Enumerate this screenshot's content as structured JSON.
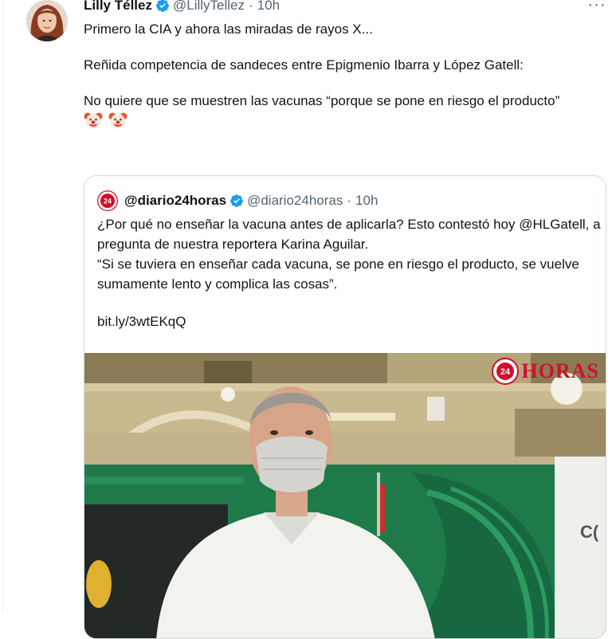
{
  "tweet": {
    "author_name": "Lilly Téllez",
    "handle": "@LillyTellez",
    "separator": "·",
    "time": "10h",
    "more": "···",
    "avatar_icon": "profile-photo-woman",
    "text": {
      "line1": "Primero la CIA y ahora las miradas de rayos X...",
      "line2": "Reñida competencia de sandeces entre Epigmenio Ibarra y López Gatell:",
      "line3": "No quiere que se muestren las vacunas “porque se pone en riesgo el producto”"
    },
    "emojis": [
      "clown-face-emoji",
      "clown-face-emoji"
    ]
  },
  "quoted": {
    "author_name": "@diario24horas",
    "handle": "@diario24horas",
    "separator": "·",
    "time": "10h",
    "avatar_icon": "diario24horas-logo",
    "text": {
      "p1": "¿Por qué no enseñar la vacuna antes de aplicarla? Esto contestó hoy @HLGatell, a pregunta de nuestra reportera Karina Aguilar.",
      "p2": "“Si se tuviera en enseñar cada vacuna, se pone en riesgo el producto, se vuelve sumamente lento  y complica las cosas”.",
      "link": "bit.ly/3wtEKqQ"
    },
    "media": {
      "watermark": "HORAS",
      "watermark_badge": "24",
      "sign_fragment": "C(",
      "colors": {
        "wall_green": "#1f7a4a",
        "watermark_red": "#d0102b"
      }
    }
  },
  "colors": {
    "verified": "#1d9bf0",
    "muted": "#536471",
    "border": "#cfd9de"
  }
}
